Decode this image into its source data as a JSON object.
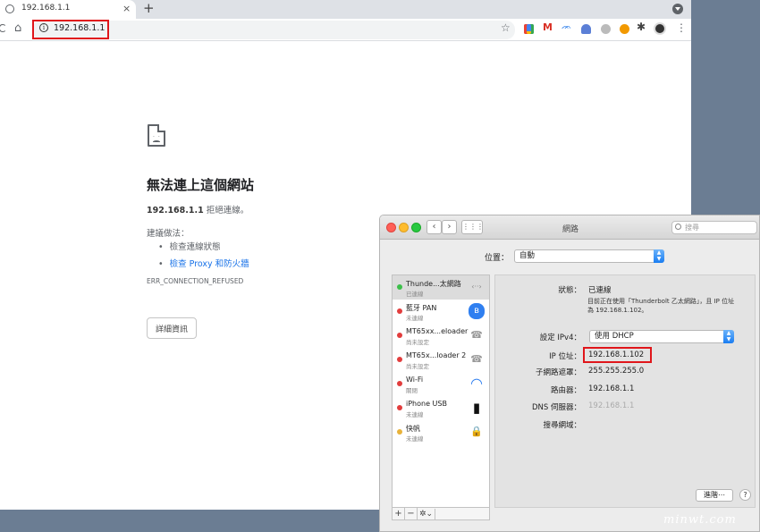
{
  "browser": {
    "tab_title": "192.168.1.1",
    "tab_close": "×",
    "new_tab": "+",
    "url": "192.168.1.1",
    "info_glyph": "i",
    "star": "☆",
    "extensions": [
      "M",
      "ᨏ",
      "✱"
    ],
    "kebab": "⋮",
    "reload": "C",
    "home": "⌂"
  },
  "error_page": {
    "title": "無法連上這個網站",
    "host": "192.168.1.1",
    "host_suffix": " 拒絕連線。",
    "suggestion_heading": "建議做法：",
    "suggestions": [
      "檢查連線狀態",
      "檢查 Proxy 和防火牆"
    ],
    "error_code": "ERR_CONNECTION_REFUSED",
    "details_button": "詳細資訊"
  },
  "network_prefs": {
    "window_title": "網路",
    "search_placeholder": "搜尋",
    "back": "‹",
    "forward": "›",
    "grid": "⋮⋮⋮",
    "location_label": "位置：",
    "location_value": "自動",
    "services": [
      {
        "name": "Thunde...太網路",
        "status": "已連線",
        "color": "#3cbf4a",
        "icon": "ethernet-icon",
        "glyph": "‹··›"
      },
      {
        "name": "藍牙 PAN",
        "status": "未連線",
        "color": "#e23d3d",
        "icon": "bluetooth-icon",
        "glyph": "ʙ"
      },
      {
        "name": "MT65xx...eloader",
        "status": "尚未設定",
        "color": "#e23d3d",
        "icon": "phone-wave-icon",
        "glyph": "☎"
      },
      {
        "name": "MT65x...loader 2",
        "status": "尚未設定",
        "color": "#e23d3d",
        "icon": "phone-wave-icon",
        "glyph": "☎"
      },
      {
        "name": "Wi-Fi",
        "status": "關閉",
        "color": "#e23d3d",
        "icon": "wifi-icon",
        "glyph": "◠"
      },
      {
        "name": "iPhone USB",
        "status": "未連線",
        "color": "#e23d3d",
        "icon": "iphone-icon",
        "glyph": "▮"
      },
      {
        "name": "快帆",
        "status": "未連線",
        "color": "#e8b23a",
        "icon": "vpn-lock-icon",
        "glyph": "🔒"
      }
    ],
    "footer": {
      "add": "+",
      "remove": "−",
      "gear": "✲⌄"
    },
    "detail": {
      "status_label": "狀態：",
      "status_value": "已連線",
      "status_note": "目前正在使用「Thunderbolt 乙太網路」，且 IP 位址為 192.168.1.102。",
      "ipv4_label": "設定 IPv4：",
      "ipv4_value": "使用 DHCP",
      "ip_label": "IP 位址：",
      "ip_value": "192.168.1.102",
      "subnet_label": "子網路遮罩：",
      "subnet_value": "255.255.255.0",
      "router_label": "路由器：",
      "router_value": "192.168.1.1",
      "dns_label": "DNS 伺服器：",
      "dns_value": "192.168.1.1",
      "search_domain_label": "搜尋網域：",
      "advanced_button": "進階⋯",
      "help_button": "?"
    }
  },
  "watermark": "minwt.com",
  "colors": {
    "highlight": "#e0161b",
    "link": "#1a73e8",
    "accent": "#1a7df2"
  }
}
